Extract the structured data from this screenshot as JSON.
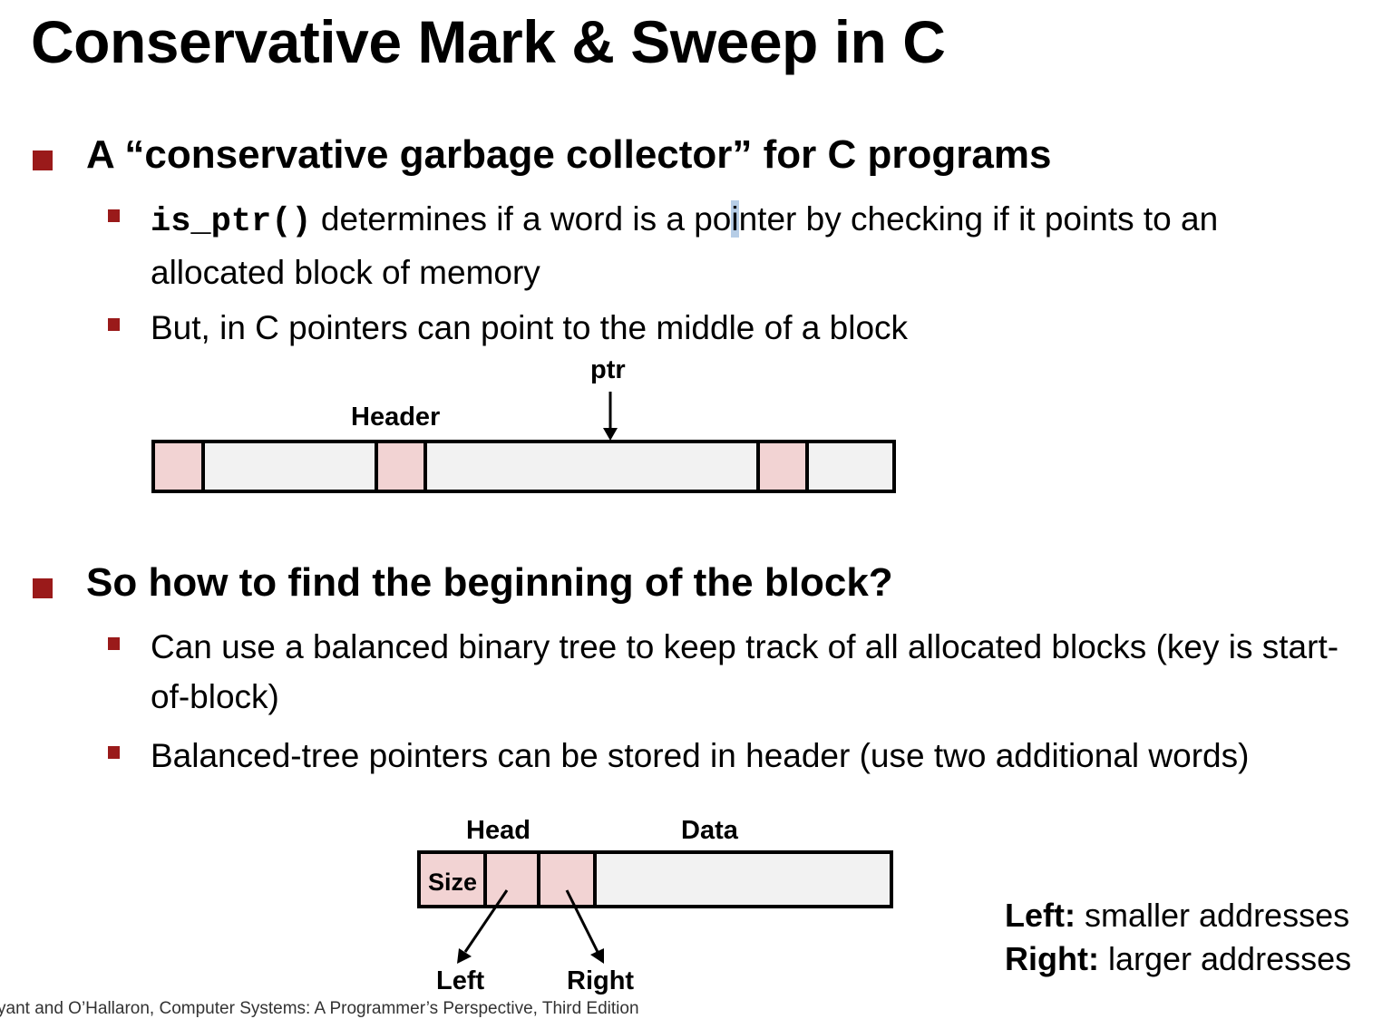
{
  "title": "Conservative Mark & Sweep in C",
  "sections": [
    {
      "heading": "A “conservative garbage collector” for C programs",
      "bullets": [
        {
          "code": "is_ptr()",
          "text_a": " determines if a word is a po",
          "text_cursor": "i",
          "text_b": "nter by checking if it points to an allocated block of memory"
        },
        {
          "text": "But, in C pointers can point to the middle of a block"
        }
      ]
    },
    {
      "heading": "So how to find the beginning of the block?",
      "bullets": [
        {
          "text": "Can use a balanced binary tree to keep track of all allocated blocks (key is start-of-block)"
        },
        {
          "text": "Balanced-tree pointers can be stored in header (use two additional words)"
        }
      ]
    }
  ],
  "diagram1": {
    "ptr_label": "ptr",
    "header_label": "Header"
  },
  "diagram2": {
    "head_label": "Head",
    "data_label": "Data",
    "size_label": "Size",
    "left_label": "Left",
    "right_label": "Right"
  },
  "legend": {
    "left_term": "Left:",
    "left_desc": " smaller addresses",
    "right_term": "Right:",
    "right_desc": " larger addresses"
  },
  "footer": "Bryant and O’Hallaron, Computer Systems: A Programmer’s Perspective, Third Edition",
  "colors": {
    "bullet": "#9a1a1a",
    "header_cell": "#f2d3d3",
    "data_cell": "#f2f2f2"
  }
}
